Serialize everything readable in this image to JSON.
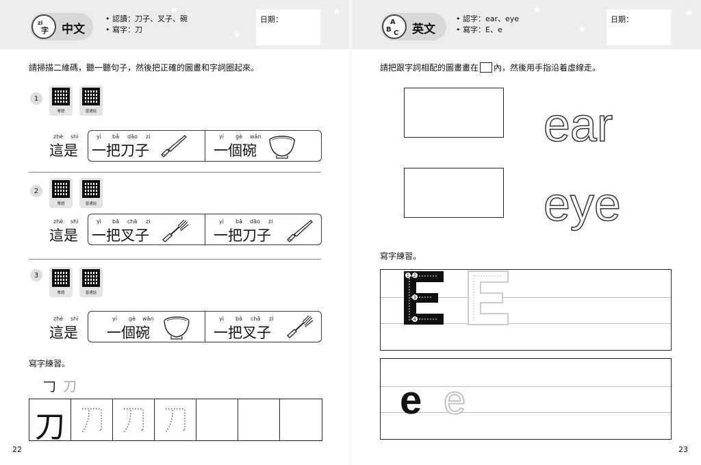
{
  "left_page": {
    "subject": "中文",
    "badge": "zi\n字",
    "bullets": [
      "認讀：刀子、叉子、碗",
      "寫字：刀"
    ],
    "date_label": "日期：",
    "instruction": "請掃描二維碼，聽一聽句子，然後把正確的圖畫和字詞圈起來。",
    "qr_captions": [
      "粵語",
      "普通話"
    ],
    "questions": [
      {
        "num": "1",
        "prefix": {
          "pinyin": [
            "zhè",
            "shì"
          ],
          "text": "這是"
        },
        "options": [
          {
            "pinyin": [
              "yì",
              "bǎ",
              "dāo",
              "zi"
            ],
            "text": "一把刀子",
            "image": "knife-icon"
          },
          {
            "pinyin": [
              "yí",
              "gè",
              "wǎn"
            ],
            "text": "一個碗",
            "image": "bowl-icon"
          }
        ]
      },
      {
        "num": "2",
        "prefix": {
          "pinyin": [
            "zhè",
            "shì"
          ],
          "text": "這是"
        },
        "options": [
          {
            "pinyin": [
              "yì",
              "bǎ",
              "chā",
              "zi"
            ],
            "text": "一把叉子",
            "image": "fork-icon"
          },
          {
            "pinyin": [
              "yì",
              "bǎ",
              "dāo",
              "zi"
            ],
            "text": "一把刀子",
            "image": "knife-icon"
          }
        ]
      },
      {
        "num": "3",
        "prefix": {
          "pinyin": [
            "zhè",
            "shì"
          ],
          "text": "這是"
        },
        "options": [
          {
            "pinyin": [
              "yí",
              "gè",
              "wǎn"
            ],
            "text": "一個碗",
            "image": "bowl-icon"
          },
          {
            "pinyin": [
              "yì",
              "bǎ",
              "chā",
              "zi"
            ],
            "text": "一把叉子",
            "image": "fork-icon"
          }
        ]
      }
    ],
    "writing_label": "寫字練習。",
    "stroke_chars": [
      "𠃌",
      "刀"
    ],
    "writing_char": "刀",
    "page_number": "22"
  },
  "right_page": {
    "subject": "英文",
    "badge": "ABC",
    "bullets": [
      "認字：ear、eye",
      "寫字：E、e"
    ],
    "date_label": "日期：",
    "instruction_before": "請把跟字詞相配的圖畫畫在",
    "instruction_after": "內，然後用手指沿着虛線走。",
    "words": [
      "ear",
      "eye"
    ],
    "writing_label": "寫字練習。",
    "uppercase_letter": "E",
    "lowercase_letter": "e",
    "stroke_numbers": [
      "1",
      "2",
      "3",
      "4"
    ],
    "page_number": "23"
  }
}
